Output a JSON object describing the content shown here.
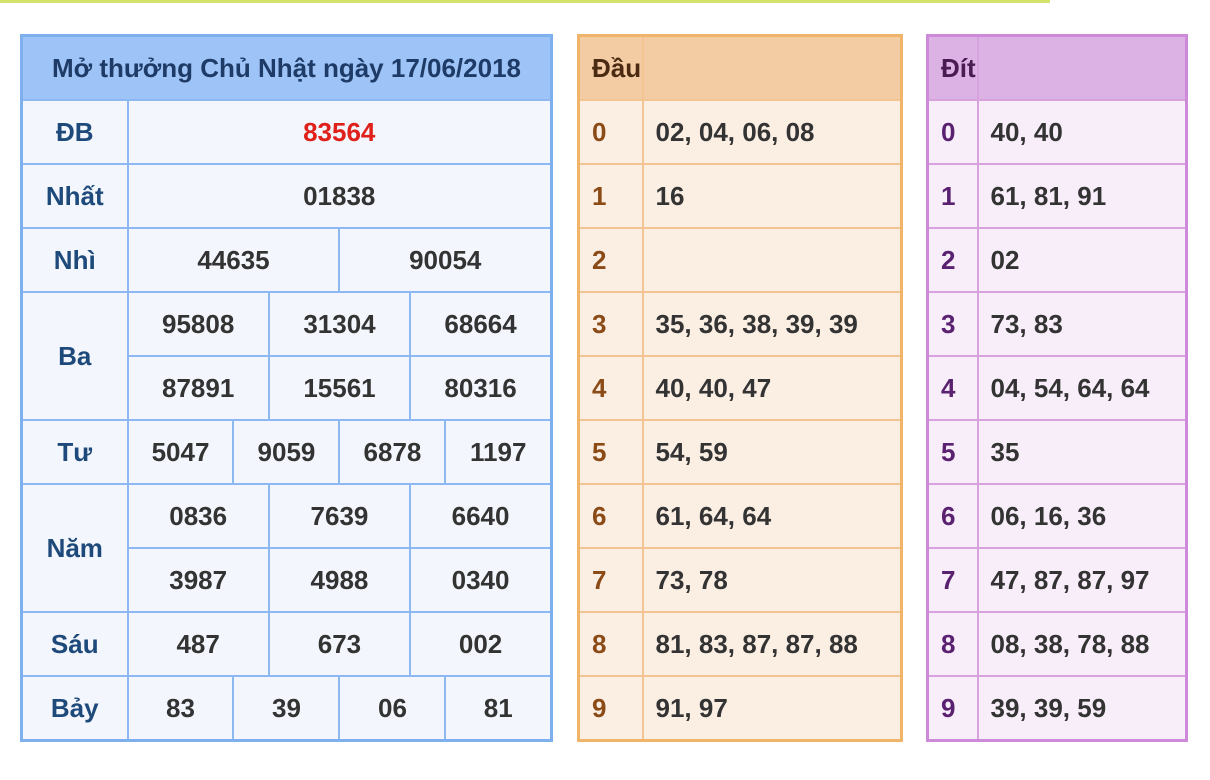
{
  "results": {
    "title": "Mở thưởng Chủ Nhật ngày 17/06/2018",
    "db": {
      "label": "ĐB",
      "value": "83564"
    },
    "nhat": {
      "label": "Nhất",
      "value": "01838"
    },
    "nhi": {
      "label": "Nhì",
      "values": [
        "44635",
        "90054"
      ]
    },
    "ba": {
      "label": "Ba",
      "values": [
        "95808",
        "31304",
        "68664",
        "87891",
        "15561",
        "80316"
      ]
    },
    "tu": {
      "label": "Tư",
      "values": [
        "5047",
        "9059",
        "6878",
        "1197"
      ]
    },
    "nam": {
      "label": "Năm",
      "values": [
        "0836",
        "7639",
        "6640",
        "3987",
        "4988",
        "0340"
      ]
    },
    "sau": {
      "label": "Sáu",
      "values": [
        "487",
        "673",
        "002"
      ]
    },
    "bay": {
      "label": "Bảy",
      "values": [
        "83",
        "39",
        "06",
        "81"
      ]
    }
  },
  "dau": {
    "header": "Đầu",
    "rows": [
      {
        "key": "0",
        "value": "02, 04, 06, 08"
      },
      {
        "key": "1",
        "value": "16"
      },
      {
        "key": "2",
        "value": ""
      },
      {
        "key": "3",
        "value": "35, 36, 38, 39, 39"
      },
      {
        "key": "4",
        "value": "40, 40, 47"
      },
      {
        "key": "5",
        "value": "54, 59"
      },
      {
        "key": "6",
        "value": "61, 64, 64"
      },
      {
        "key": "7",
        "value": "73, 78"
      },
      {
        "key": "8",
        "value": "81, 83, 87, 87, 88"
      },
      {
        "key": "9",
        "value": "91, 97"
      }
    ]
  },
  "dit": {
    "header": "Đít",
    "rows": [
      {
        "key": "0",
        "value": "40, 40"
      },
      {
        "key": "1",
        "value": "61, 81, 91"
      },
      {
        "key": "2",
        "value": "02"
      },
      {
        "key": "3",
        "value": "73, 83"
      },
      {
        "key": "4",
        "value": "04, 54, 64, 64"
      },
      {
        "key": "5",
        "value": "35"
      },
      {
        "key": "6",
        "value": "06, 16, 36"
      },
      {
        "key": "7",
        "value": "47, 87, 87, 97"
      },
      {
        "key": "8",
        "value": "08, 38, 78, 88"
      },
      {
        "key": "9",
        "value": "39, 39, 59"
      }
    ]
  },
  "colors": {
    "special_prize": "#e0201a",
    "results_header": "#9ec3f6",
    "dau_header": "#f4cca4",
    "dit_header": "#dcb2e4"
  }
}
